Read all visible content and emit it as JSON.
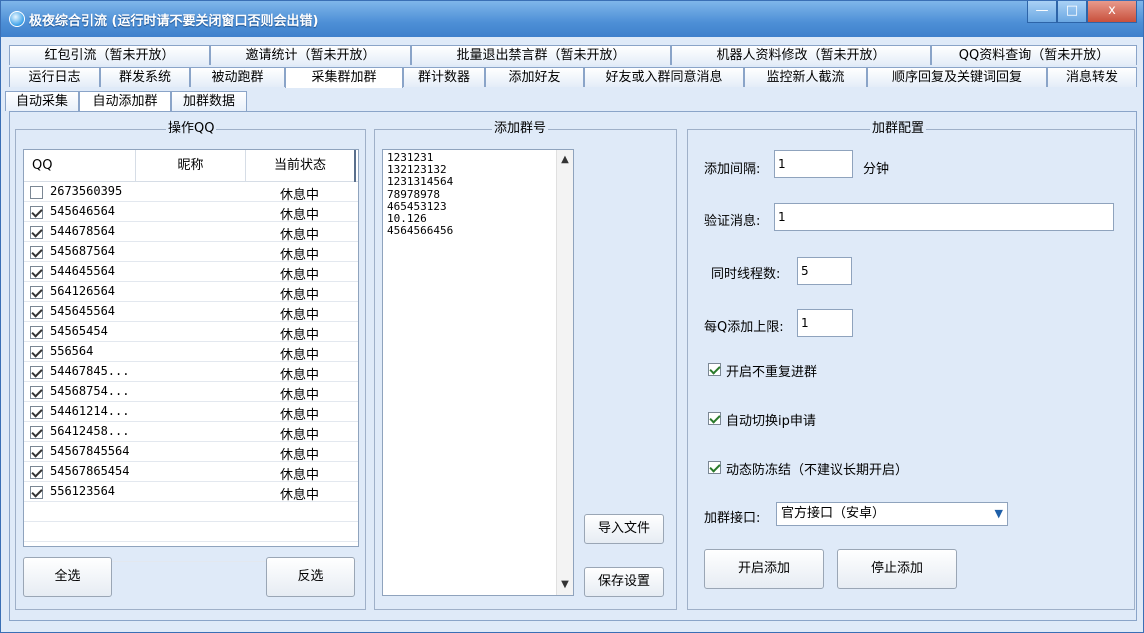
{
  "window": {
    "title": "极夜综合引流 (运行时请不要关闭窗口否则会出错)",
    "min_glyph": "—",
    "max_glyph": "□",
    "close_glyph": "x"
  },
  "tabs_row1": [
    "红包引流（暂未开放）",
    "邀请统计（暂未开放）",
    "批量退出禁言群（暂未开放）",
    "机器人资料修改（暂未开放）",
    "QQ资料查询（暂未开放）"
  ],
  "tabs_row2": [
    "运行日志",
    "群发系统",
    "被动跑群",
    "采集群加群",
    "群计数器",
    "添加好友",
    "好友或入群同意消息",
    "监控新人截流",
    "顺序回复及关键词回复",
    "消息转发"
  ],
  "subtabs": [
    "自动采集",
    "自动添加群",
    "加群数据"
  ],
  "active_tab_row2": 3,
  "active_subtab": 1,
  "operate_group": {
    "title": "操作QQ",
    "columns": [
      "QQ",
      "昵称",
      "当前状态"
    ],
    "rows": [
      {
        "qq": "2673560395",
        "nick": "",
        "status": "休息中",
        "checked": false
      },
      {
        "qq": "545646564",
        "nick": "",
        "status": "休息中",
        "checked": true
      },
      {
        "qq": "544678564",
        "nick": "",
        "status": "休息中",
        "checked": true
      },
      {
        "qq": "545687564",
        "nick": "",
        "status": "休息中",
        "checked": true
      },
      {
        "qq": "544645564",
        "nick": "",
        "status": "休息中",
        "checked": true
      },
      {
        "qq": "564126564",
        "nick": "",
        "status": "休息中",
        "checked": true
      },
      {
        "qq": "545645564",
        "nick": "",
        "status": "休息中",
        "checked": true
      },
      {
        "qq": "54565454",
        "nick": "",
        "status": "休息中",
        "checked": true
      },
      {
        "qq": "556564",
        "nick": "",
        "status": "休息中",
        "checked": true
      },
      {
        "qq": "54467845...",
        "nick": "",
        "status": "休息中",
        "checked": true
      },
      {
        "qq": "54568754...",
        "nick": "",
        "status": "休息中",
        "checked": true
      },
      {
        "qq": "54461214...",
        "nick": "",
        "status": "休息中",
        "checked": true
      },
      {
        "qq": "56412458...",
        "nick": "",
        "status": "休息中",
        "checked": true
      },
      {
        "qq": "54567845564",
        "nick": "",
        "status": "休息中",
        "checked": true
      },
      {
        "qq": "54567865454",
        "nick": "",
        "status": "休息中",
        "checked": true
      },
      {
        "qq": "556123564",
        "nick": "",
        "status": "休息中",
        "checked": true
      }
    ],
    "select_all_label": "全选",
    "invert_label": "反选"
  },
  "add_group": {
    "title": "添加群号",
    "numbers_text": "1231231\n132123132\n1231314564\n78978978\n465453123\n10.126\n4564566456",
    "import_label": "导入文件",
    "save_label": "保存设置"
  },
  "config": {
    "title": "加群配置",
    "interval_label": "添加间隔:",
    "interval_value": "1",
    "interval_unit": "分钟",
    "verify_label": "验证消息:",
    "verify_value": "1",
    "threads_label": "同时线程数:",
    "threads_value": "5",
    "limit_label": "每Q添加上限:",
    "limit_value": "1",
    "opt_no_repeat": "开启不重复进群",
    "opt_no_repeat_checked": true,
    "opt_switch_ip": "自动切换ip申请",
    "opt_switch_ip_checked": true,
    "opt_anti_freeze": "动态防冻结（不建议长期开启）",
    "opt_anti_freeze_checked": true,
    "interface_label": "加群接口:",
    "interface_value": "官方接口（安卓）",
    "start_label": "开启添加",
    "stop_label": "停止添加"
  }
}
